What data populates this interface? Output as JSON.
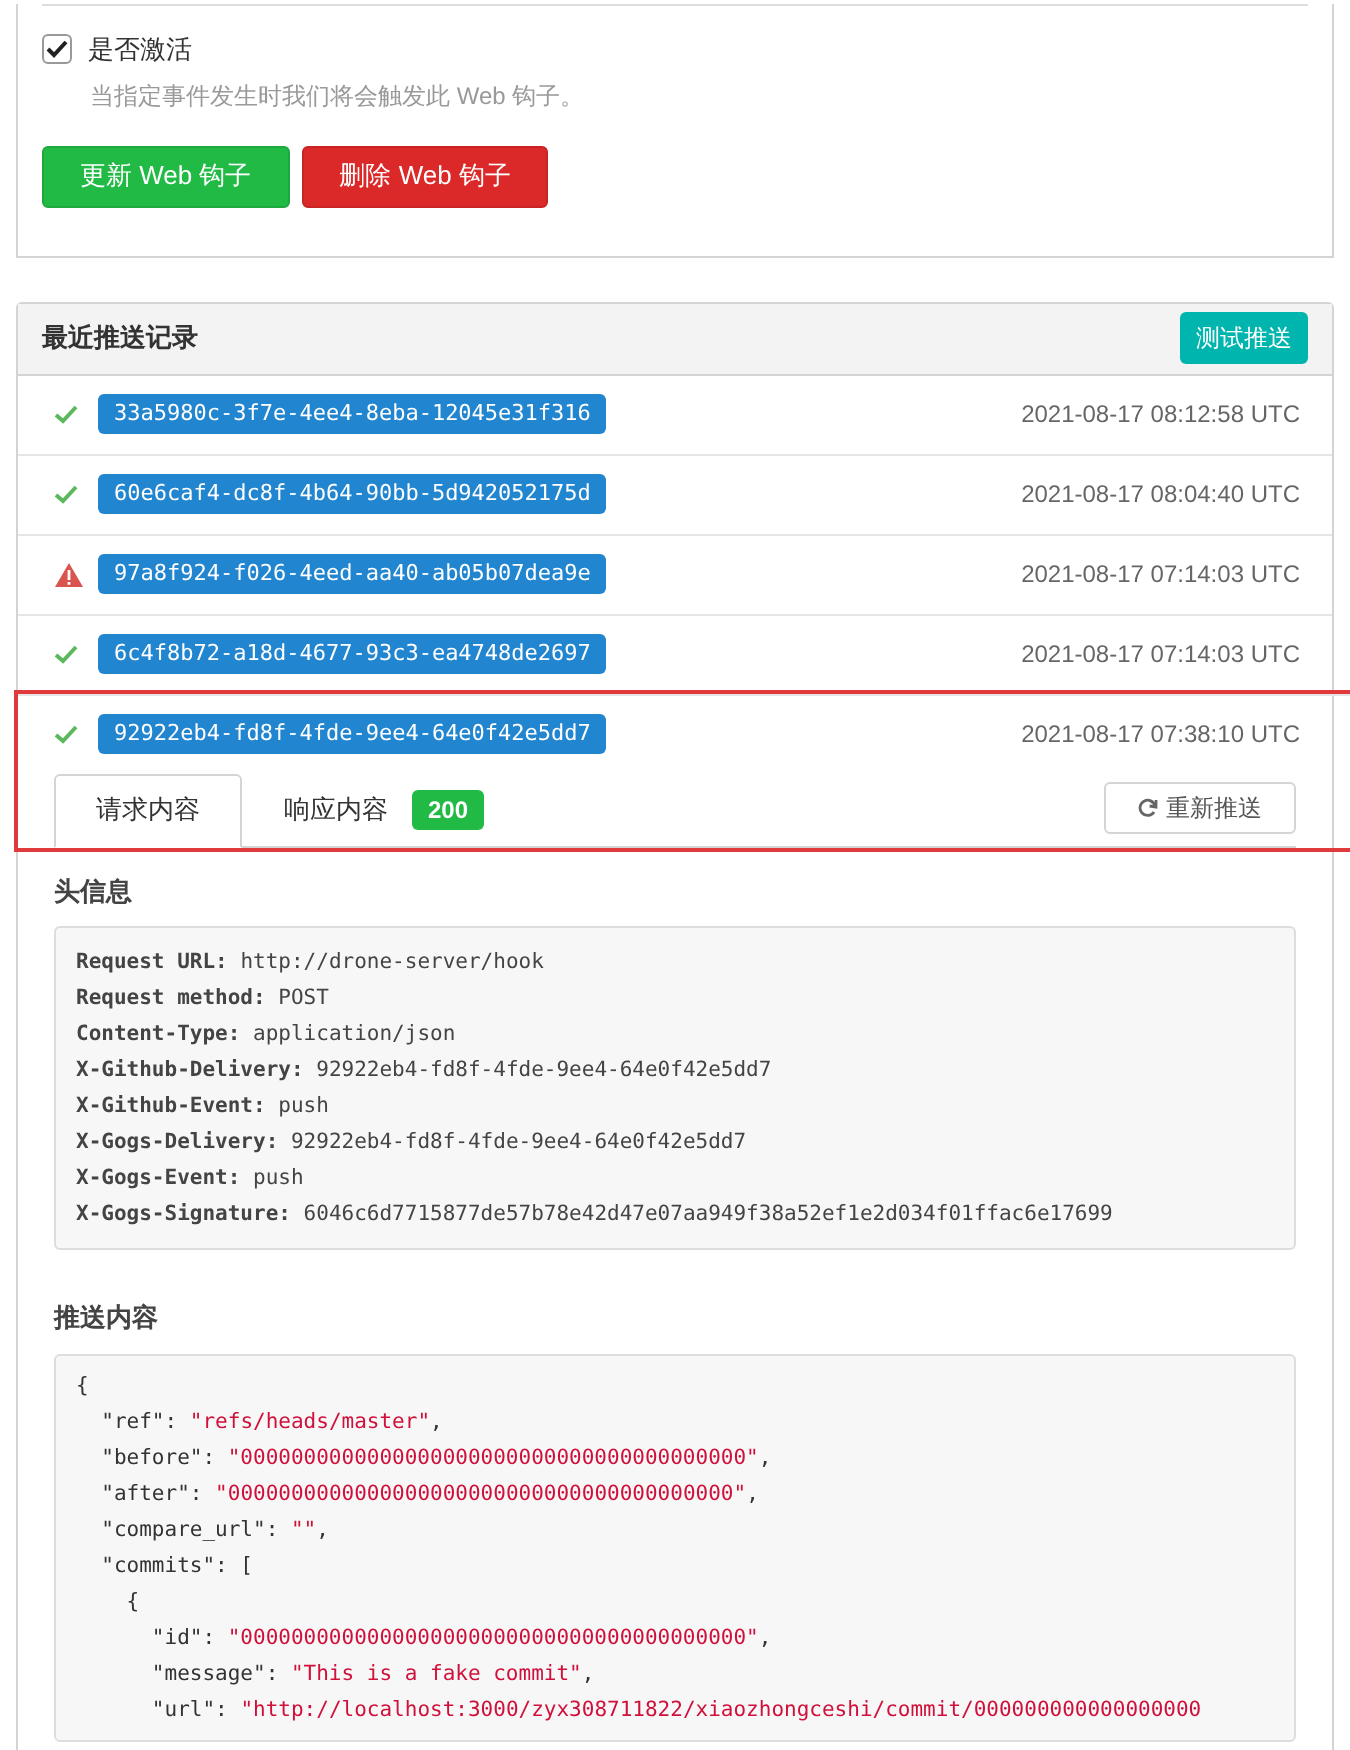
{
  "active_setting": {
    "label": "是否激活",
    "checked": true,
    "help": "当指定事件发生时我们将会触发此 Web 钩子。"
  },
  "actions": [
    {
      "label": "更新 Web 钩子",
      "kind": "update"
    },
    {
      "label": "删除 Web 钩子",
      "kind": "delete"
    }
  ],
  "deliveries": {
    "title": "最近推送记录",
    "test_button": "测试推送",
    "items": [
      {
        "id": "33a5980c-3f7e-4ee4-8eba-12045e31f316",
        "time": "2021-08-17 08:12:58 UTC",
        "kind": "success",
        "expanded": false,
        "highlighted": false
      },
      {
        "id": "60e6caf4-dc8f-4b64-90bb-5d942052175d",
        "time": "2021-08-17 08:04:40 UTC",
        "kind": "success",
        "expanded": false,
        "highlighted": false
      },
      {
        "id": "97a8f924-f026-4eed-aa40-ab05b07dea9e",
        "time": "2021-08-17 07:14:03 UTC",
        "kind": "failure",
        "expanded": false,
        "highlighted": false
      },
      {
        "id": "6c4f8b72-a18d-4677-93c3-ea4748de2697",
        "time": "2021-08-17 07:14:03 UTC",
        "kind": "success",
        "expanded": false,
        "highlighted": false
      },
      {
        "id": "92922eb4-fd8f-4fde-9ee4-64e0f42e5dd7",
        "time": "2021-08-17 07:38:10 UTC",
        "kind": "success",
        "expanded": true,
        "highlighted": true
      }
    ],
    "tabs": [
      {
        "label": "请求内容",
        "selected": true
      },
      {
        "label": "响应内容",
        "selected": false,
        "badge": "200"
      }
    ],
    "redeliver_button": "重新推送",
    "headers_title": "头信息",
    "headers": [
      {
        "name": "Request URL:",
        "value": "http://drone-server/hook"
      },
      {
        "name": "Request method:",
        "value": "POST"
      },
      {
        "name": "Content-Type:",
        "value": "application/json"
      },
      {
        "name": "X-Github-Delivery:",
        "value": "92922eb4-fd8f-4fde-9ee4-64e0f42e5dd7"
      },
      {
        "name": "X-Github-Event:",
        "value": "push"
      },
      {
        "name": "X-Gogs-Delivery:",
        "value": "92922eb4-fd8f-4fde-9ee4-64e0f42e5dd7"
      },
      {
        "name": "X-Gogs-Event:",
        "value": "push"
      },
      {
        "name": "X-Gogs-Signature:",
        "value": "6046c6d7715877de57b78e42d47e07aa949f38a52ef1e2d034f01ffac6e17699"
      }
    ],
    "payload_title": "推送内容",
    "payload": [
      [
        {
          "kind": "plain",
          "text": "{"
        }
      ],
      [
        {
          "kind": "plain",
          "text": "  \"ref\": "
        },
        {
          "kind": "string",
          "text": "\"refs/heads/master\""
        },
        {
          "kind": "plain",
          "text": ","
        }
      ],
      [
        {
          "kind": "plain",
          "text": "  \"before\": "
        },
        {
          "kind": "string",
          "text": "\"0000000000000000000000000000000000000000\""
        },
        {
          "kind": "plain",
          "text": ","
        }
      ],
      [
        {
          "kind": "plain",
          "text": "  \"after\": "
        },
        {
          "kind": "string",
          "text": "\"0000000000000000000000000000000000000000\""
        },
        {
          "kind": "plain",
          "text": ","
        }
      ],
      [
        {
          "kind": "plain",
          "text": "  \"compare_url\": "
        },
        {
          "kind": "string",
          "text": "\"\""
        },
        {
          "kind": "plain",
          "text": ","
        }
      ],
      [
        {
          "kind": "plain",
          "text": "  \"commits\": ["
        }
      ],
      [
        {
          "kind": "plain",
          "text": "    {"
        }
      ],
      [
        {
          "kind": "plain",
          "text": "      \"id\": "
        },
        {
          "kind": "string",
          "text": "\"0000000000000000000000000000000000000000\""
        },
        {
          "kind": "plain",
          "text": ","
        }
      ],
      [
        {
          "kind": "plain",
          "text": "      \"message\": "
        },
        {
          "kind": "string",
          "text": "\"This is a fake commit\""
        },
        {
          "kind": "plain",
          "text": ","
        }
      ],
      [
        {
          "kind": "plain",
          "text": "      \"url\": "
        },
        {
          "kind": "string",
          "text": "\"http://localhost:3000/zyx308711822/xiaozhongceshi/commit/000000000000000000"
        }
      ]
    ]
  }
}
